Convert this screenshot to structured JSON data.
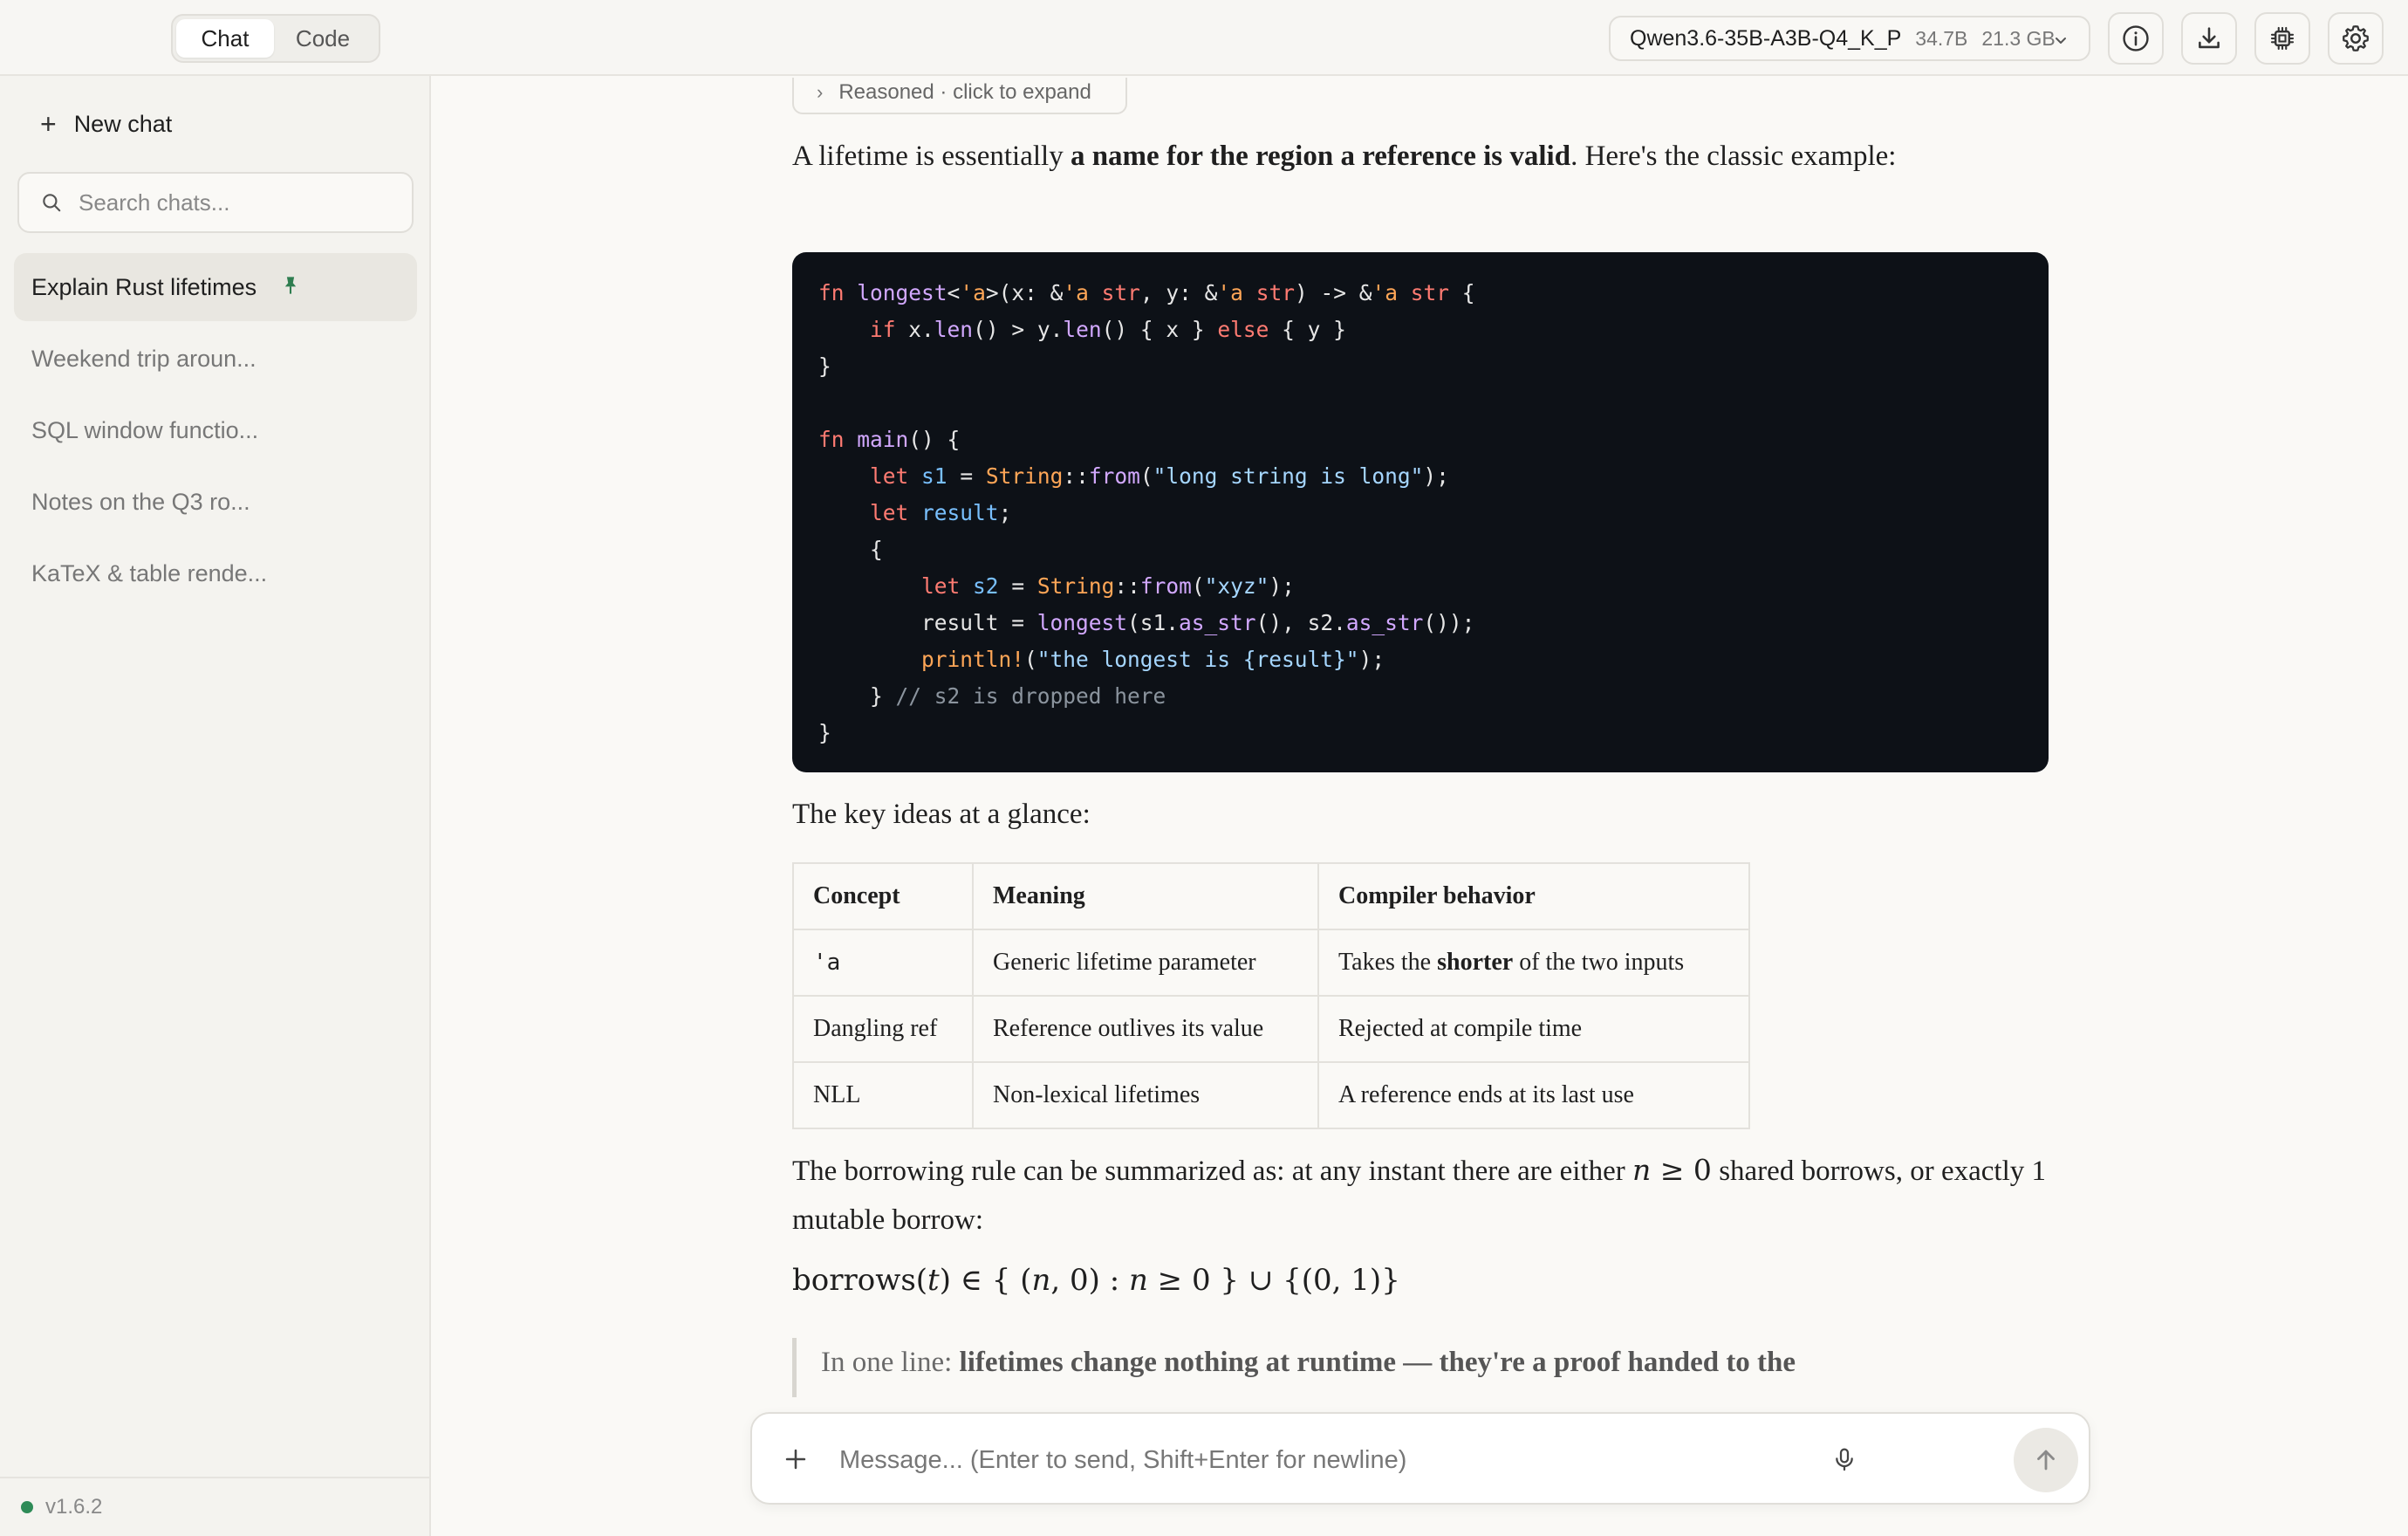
{
  "header": {
    "mode_chat": "Chat",
    "mode_code": "Code",
    "model_name": "Qwen3.6-35B-A3B-Q4_K_P",
    "model_params": "34.7B",
    "model_size": "21.3 GB"
  },
  "sidebar": {
    "new_chat_label": "New chat",
    "search_placeholder": "Search chats...",
    "chats": [
      {
        "label": "Explain Rust lifetimes",
        "pinned": true
      },
      {
        "label": "Weekend trip aroun..."
      },
      {
        "label": "SQL window functio..."
      },
      {
        "label": "Notes on the Q3 ro..."
      },
      {
        "label": "KaTeX & table rende..."
      }
    ],
    "version": "v1.6.2"
  },
  "message": {
    "reasoned_label": "Reasoned · click to expand",
    "intro_before": "A lifetime is essentially ",
    "intro_bold": "a name for the region a reference is valid",
    "intro_after": ". Here's the classic example:",
    "key_ideas": "The key ideas at a glance:",
    "table": {
      "headers": [
        "Concept",
        "Meaning",
        "Compiler behavior"
      ],
      "rows": [
        {
          "concept": "'a",
          "meaning": "Generic lifetime parameter",
          "behavior_before": "Takes the ",
          "behavior_bold": "shorter",
          "behavior_after": " of the two inputs"
        },
        {
          "concept": "Dangling ref",
          "meaning": "Reference outlives its value",
          "behavior": "Rejected at compile time"
        },
        {
          "concept": "NLL",
          "meaning": "Non-lexical lifetimes",
          "behavior": "A reference ends at its last use"
        }
      ]
    },
    "borrow_before": "The borrowing rule can be summarized as: at any instant there are either ",
    "borrow_after": " shared borrows, or exactly 1 mutable borrow:",
    "blockquote_prefix": "In one line: ",
    "blockquote_bold": "lifetimes change nothing at runtime — they're a proof handed to the"
  },
  "composer": {
    "placeholder": "Message... (Enter to send, Shift+Enter for newline)"
  }
}
